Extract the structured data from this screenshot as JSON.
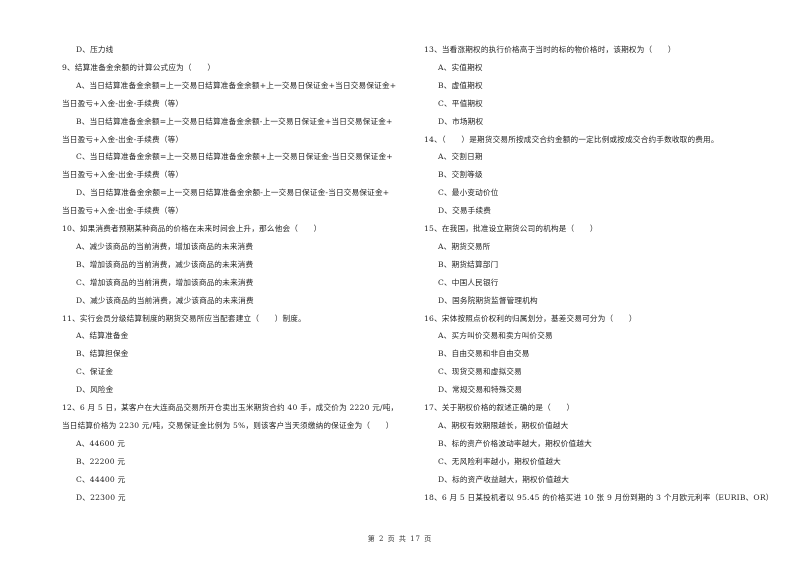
{
  "left_column": [
    {
      "type": "option",
      "text": "D、压力线"
    },
    {
      "type": "question",
      "text": "9、结算准备金余额的计算公式应为（　　）"
    },
    {
      "type": "option",
      "text": "A、当日结算准备金余额=上一交易日结算准备金余额+上一交易日保证金+当日交易保证金+"
    },
    {
      "type": "cont",
      "text": "当日盈亏+入金-出金-手续费（等）"
    },
    {
      "type": "option",
      "text": "B、当日结算准备金余额=上一交易日结算准备金余额-上一交易日保证金+当日交易保证金+"
    },
    {
      "type": "cont",
      "text": "当日盈亏+入金-出金-手续费（等）"
    },
    {
      "type": "option",
      "text": "C、当日结算准备金余额=上一交易日结算准备金余额+上一交易日保证金-当日交易保证金+"
    },
    {
      "type": "cont",
      "text": "当日盈亏+入金-出金-手续费（等）"
    },
    {
      "type": "option",
      "text": "D、当日结算准备金余额=上一交易日结算准备金余额-上一交易日保证金-当日交易保证金+"
    },
    {
      "type": "cont",
      "text": "当日盈亏+入金-出金-手续费（等）"
    },
    {
      "type": "question",
      "text": "10、如果消费者预期某种商品的价格在未来时间会上升，那么他会（　　）"
    },
    {
      "type": "option",
      "text": "A、减少该商品的当前消费，增加该商品的未来消费"
    },
    {
      "type": "option",
      "text": "B、增加该商品的当前消费，减少该商品的未来消费"
    },
    {
      "type": "option",
      "text": "C、增加该商品的当前消费，增加该商品的未来消费"
    },
    {
      "type": "option",
      "text": "D、减少该商品的当前消费，减少该商品的未来消费"
    },
    {
      "type": "question",
      "text": "11、实行会员分级结算制度的期货交易所应当配套建立（　　）制度。"
    },
    {
      "type": "option",
      "text": "A、结算准备金"
    },
    {
      "type": "option",
      "text": "B、结算担保金"
    },
    {
      "type": "option",
      "text": "C、保证金"
    },
    {
      "type": "option",
      "text": "D、风险金"
    },
    {
      "type": "question",
      "text": "12、6 月 5 日，某客户在大连商品交易所开仓卖出玉米期货合约 40 手，成交价为 2220 元/吨，"
    },
    {
      "type": "cont",
      "text": "当日结算价格为 2230 元/吨，交易保证金比例为 5%，则该客户当天须缴纳的保证金为（　　）"
    },
    {
      "type": "option",
      "text": "A、44600 元"
    },
    {
      "type": "option",
      "text": "B、22200 元"
    },
    {
      "type": "option",
      "text": "C、44400 元"
    },
    {
      "type": "option",
      "text": "D、22300 元"
    }
  ],
  "right_column": [
    {
      "type": "question",
      "text": "13、当看涨期权的执行价格高于当时的标的物价格时，该期权为（　　）"
    },
    {
      "type": "option",
      "text": "A、实值期权"
    },
    {
      "type": "option",
      "text": "B、虚值期权"
    },
    {
      "type": "option",
      "text": "C、平值期权"
    },
    {
      "type": "option",
      "text": "D、市场期权"
    },
    {
      "type": "question",
      "text": "14、（　　）是期货交易所按成交合约金额的一定比例或按成交合约手数收取的费用。"
    },
    {
      "type": "option",
      "text": "A、交割日期"
    },
    {
      "type": "option",
      "text": "B、交割等级"
    },
    {
      "type": "option",
      "text": "C、最小变动价位"
    },
    {
      "type": "option",
      "text": "D、交易手续费"
    },
    {
      "type": "question",
      "text": "15、在我国，批准设立期货公司的机构是（　　）"
    },
    {
      "type": "option",
      "text": "A、期货交易所"
    },
    {
      "type": "option",
      "text": "B、期货结算部门"
    },
    {
      "type": "option",
      "text": "C、中国人民银行"
    },
    {
      "type": "option",
      "text": "D、国务院期货监督管理机构"
    },
    {
      "type": "question",
      "text": "16、宋体按照点价权利的归属划分，基差交易可分为（　　）"
    },
    {
      "type": "option",
      "text": "A、买方叫价交易和卖方叫价交易"
    },
    {
      "type": "option",
      "text": "B、自由交易和非自由交易"
    },
    {
      "type": "option",
      "text": "C、现货交易和虚拟交易"
    },
    {
      "type": "option",
      "text": "D、常规交易和特殊交易"
    },
    {
      "type": "question",
      "text": "17、关于期权价格的叙述正确的是（　　）"
    },
    {
      "type": "option",
      "text": "A、期权有效期限越长，期权价值越大"
    },
    {
      "type": "option",
      "text": "B、标的资产价格波动率越大，期权价值越大"
    },
    {
      "type": "option",
      "text": "C、无风险利率越小，期权价值越大"
    },
    {
      "type": "option",
      "text": "D、标的资产收益越大，期权价值越大"
    },
    {
      "type": "question",
      "text": "18、6 月 5 日某投机者以 95.45 的价格买进 10 张 9 月份到期的 3 个月欧元利率（EURIB、OR）"
    }
  ],
  "footer": {
    "page_label": "第 2 页 共 17 页"
  }
}
